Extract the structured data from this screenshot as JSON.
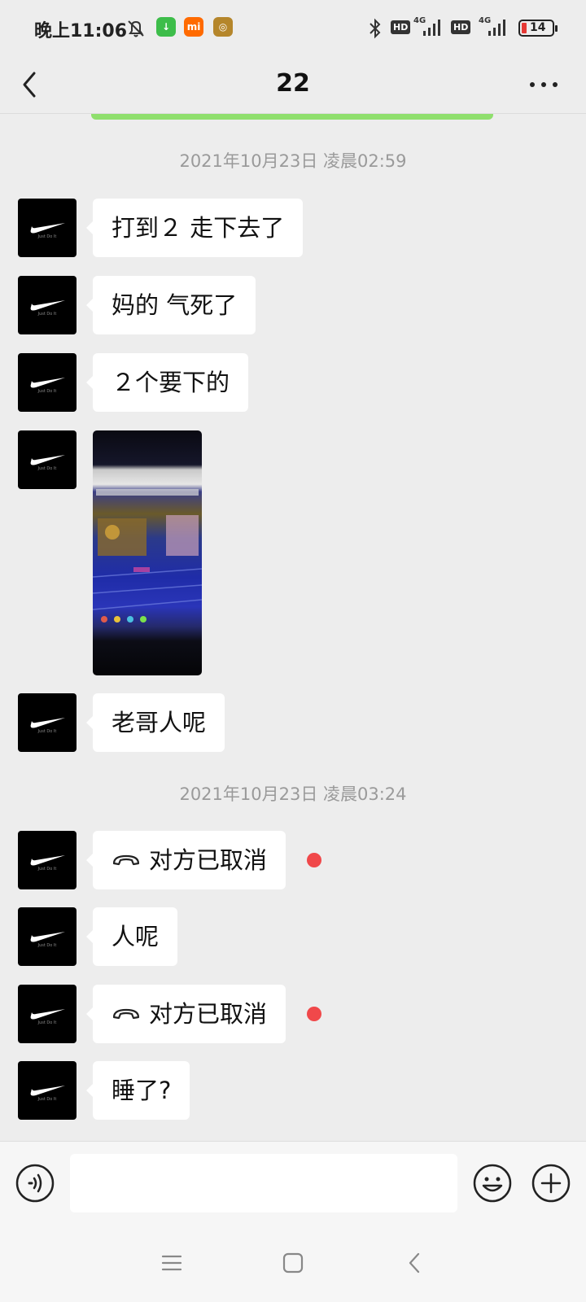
{
  "status_bar": {
    "time": "晚上11:06",
    "app_icons": [
      {
        "name": "download-icon",
        "color": "#3dbd4a",
        "glyph": "↓"
      },
      {
        "name": "mi-icon",
        "color": "#ff6a00",
        "glyph": "mi"
      },
      {
        "name": "game-icon",
        "color": "#b5862b",
        "glyph": "◎"
      }
    ],
    "network_1": "4G",
    "network_2": "4G",
    "hd_label": "HD",
    "battery_level": "14"
  },
  "header": {
    "title": "22",
    "back_icon": "chevron-left-icon",
    "more_icon": "more-dots-icon"
  },
  "messages": {
    "timestamp_1": "2021年10月23日 凌晨02:59",
    "msg_1": "打到２ 走下去了",
    "msg_2": "妈的 气死了",
    "msg_3": "２个要下的",
    "msg_5": "老哥人呢",
    "timestamp_2": "2021年10月23日 凌晨03:24",
    "call_1": "对方已取消",
    "msg_7": "人呢",
    "call_2": "对方已取消",
    "msg_9": "睡了?",
    "avatar_tagline": "Just Do It"
  },
  "input_bar": {
    "placeholder": "",
    "voice_icon": "voice-icon",
    "emoji_icon": "emoji-icon",
    "plus_icon": "plus-icon"
  },
  "nav_bar": {
    "menu_icon": "menu-icon",
    "home_icon": "home-square-icon",
    "back_icon": "back-triangle-icon"
  },
  "colors": {
    "background": "#ededed",
    "bubble": "#ffffff",
    "unread_dot": "#f0484a",
    "green_strip": "#8fdf6d"
  }
}
